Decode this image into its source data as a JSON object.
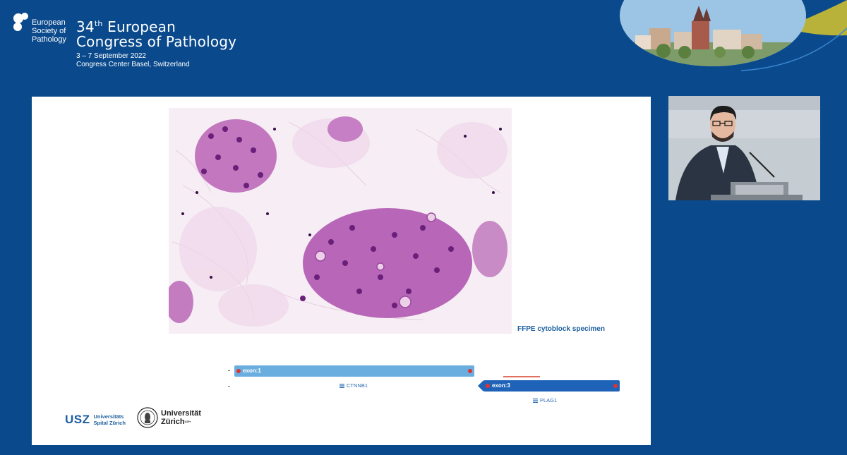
{
  "header": {
    "society": [
      "European",
      "Society of",
      "Pathology"
    ],
    "congress_number": "34",
    "congress_ordinal": "th",
    "congress_line1": "European",
    "congress_line2": "Congress of Pathology",
    "dates": "3 – 7 September 2022",
    "venue": "Congress Center Basel, Switzerland"
  },
  "slide": {
    "caption": "FFPE cytoblock specimen",
    "fusion": {
      "gene1": {
        "exon_label": "exon:1",
        "gene_name": "CTNNB1"
      },
      "gene2": {
        "exon_label": "exon:3",
        "gene_name": "PLAG1"
      }
    },
    "logos": {
      "usz_abbrev": "USZ",
      "usz_line1": "Universitäts",
      "usz_line2": "Spital Zürich",
      "uzh_line1": "Universität",
      "uzh_line2": "Zürich",
      "uzh_sup": "UZH"
    }
  },
  "colors": {
    "background": "#0a4a8c",
    "accent_olive": "#b8b23a",
    "ctnnb1_bar": "#6aaee0",
    "plag1_bar": "#1f63b8",
    "caption_text": "#1d5fa0"
  }
}
